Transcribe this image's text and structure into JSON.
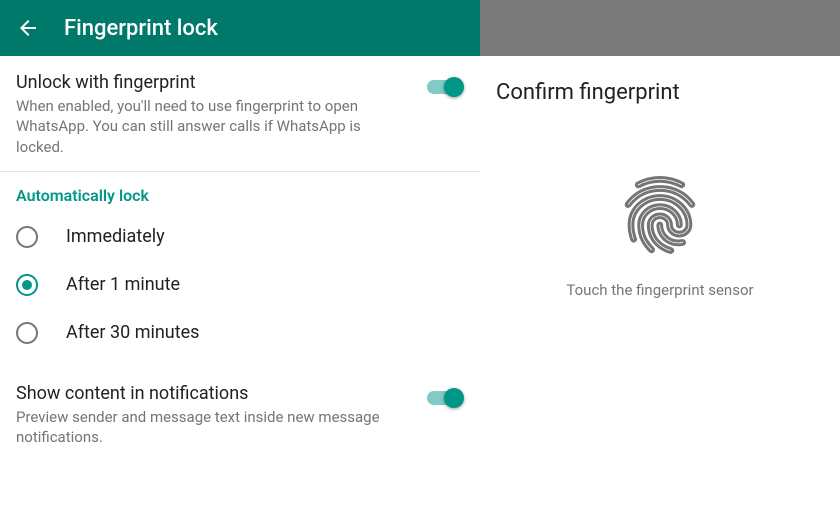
{
  "colors": {
    "accent": "#009688",
    "appbar": "#00796b"
  },
  "appbar": {
    "title": "Fingerprint lock"
  },
  "settings": {
    "unlock": {
      "title": "Unlock with fingerprint",
      "desc": "When enabled, you'll need to use fingerprint to open WhatsApp. You can still answer calls if WhatsApp is locked.",
      "enabled": true
    },
    "autolock": {
      "header": "Automatically lock",
      "options": [
        {
          "label": "Immediately",
          "selected": false
        },
        {
          "label": "After 1 minute",
          "selected": true
        },
        {
          "label": "After 30 minutes",
          "selected": false
        }
      ]
    },
    "notifications": {
      "title": "Show content in notifications",
      "desc": "Preview sender and message text inside new message notifications.",
      "enabled": true
    }
  },
  "confirm": {
    "title": "Confirm fingerprint",
    "instruction": "Touch the fingerprint sensor"
  }
}
